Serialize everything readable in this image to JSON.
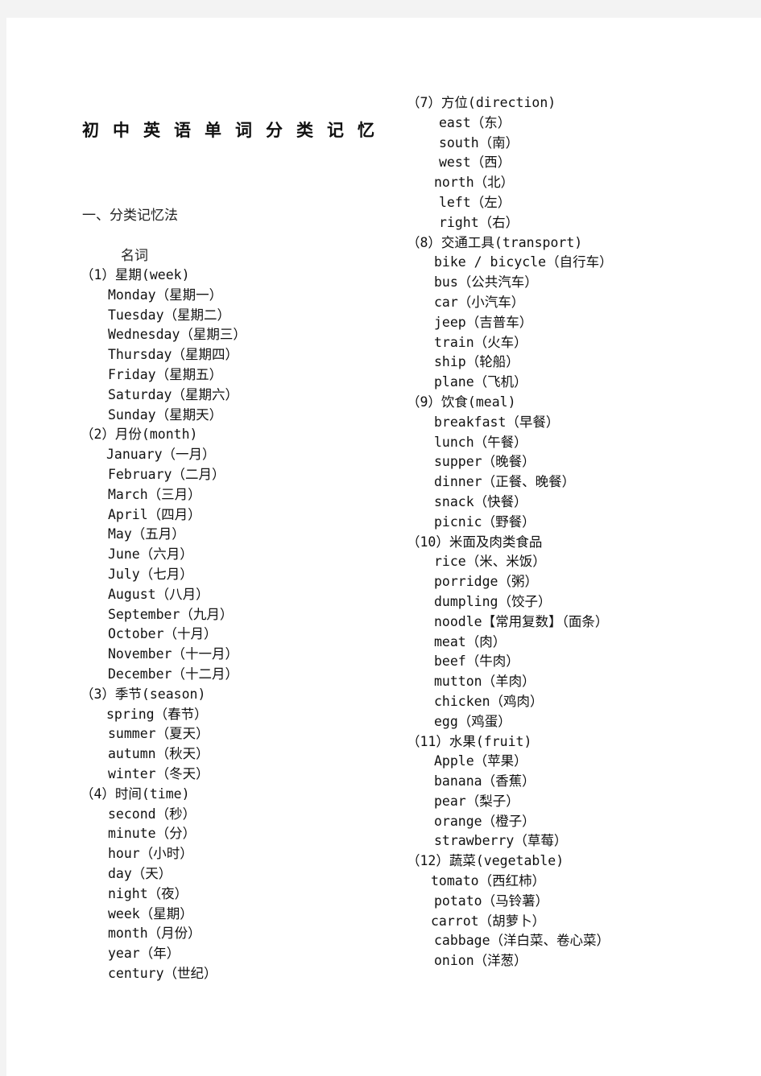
{
  "document": {
    "title": "初中英语单词分类记忆",
    "section_heading": "一、分类记忆法",
    "subheading": "名词"
  },
  "left_column": [
    {
      "label": "（1）星期(week)",
      "items": [
        "Monday（星期一）",
        "Tuesday（星期二）",
        "Wednesday（星期三）",
        "Thursday（星期四）",
        "Friday（星期五）",
        "Saturday（星期六）",
        "Sunday（星期天）"
      ]
    },
    {
      "label": "（2）月份(month)",
      "items": [
        "January（一月）",
        "February（二月）",
        "March（三月）",
        "April（四月）",
        "May（五月）",
        "June（六月）",
        "July（七月）",
        "August（八月）",
        "September（九月）",
        "October（十月）",
        "November（十一月）",
        "December（十二月）"
      ]
    },
    {
      "label": "（3）季节(season)",
      "items": [
        "spring（春节）",
        "summer（夏天）",
        "autumn（秋天）",
        "winter（冬天）"
      ]
    },
    {
      "label": "（4）时间(time)",
      "items": [
        "second（秒）",
        "minute（分）",
        "hour（小时）",
        "day（天）",
        "night（夜）",
        "week（星期）",
        "month（月份）",
        "year（年）",
        "century（世纪）"
      ]
    }
  ],
  "right_column": [
    {
      "label": "（7）方位(direction)",
      "items": [
        "east（东）",
        "south（南）",
        "west（西）",
        "north（北）",
        "left（左）",
        "right（右）"
      ]
    },
    {
      "label": "（8）交通工具(transport)",
      "items": [
        "bike / bicycle（自行车）",
        "bus（公共汽车）",
        "car（小汽车）",
        "jeep（吉普车）",
        "train（火车）",
        "ship（轮船）",
        "plane（飞机）"
      ]
    },
    {
      "label": "（9）饮食(meal)",
      "items": [
        "breakfast（早餐）",
        "lunch（午餐）",
        "supper（晚餐）",
        "dinner（正餐、晚餐）",
        "snack（快餐）",
        "picnic（野餐）"
      ]
    },
    {
      "label": "（10）米面及肉类食品",
      "items": [
        "rice（米、米饭）",
        "porridge（粥）",
        "dumpling（饺子）",
        "noodle【常用复数】（面条）",
        "meat（肉）",
        "beef（牛肉）",
        "mutton（羊肉）",
        "chicken（鸡肉）",
        "egg（鸡蛋）"
      ]
    },
    {
      "label": "（11）水果(fruit)",
      "items": [
        "Apple（苹果）",
        "banana（香蕉）",
        "pear（梨子）",
        "orange（橙子）",
        "strawberry（草莓）"
      ]
    },
    {
      "label": "（12）蔬菜(vegetable)",
      "items": [
        "tomato（西红柿）",
        "potato（马铃薯）",
        "carrot（胡萝卜）",
        "cabbage（洋白菜、卷心菜）",
        "onion（洋葱）"
      ]
    }
  ]
}
